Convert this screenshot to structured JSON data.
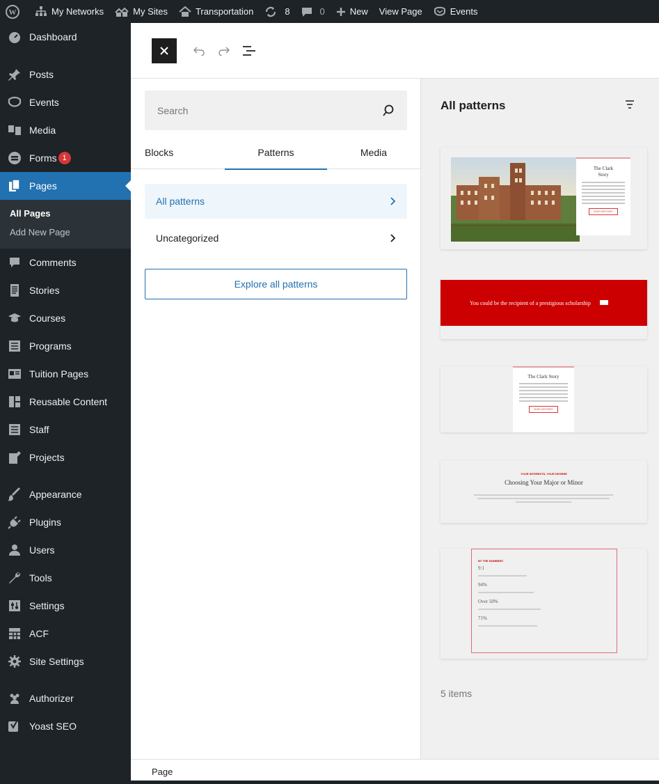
{
  "admin_bar": {
    "my_networks": "My Networks",
    "my_sites": "My Sites",
    "site_name": "Transportation",
    "updates_count": "8",
    "comments_count": "0",
    "new_label": "New",
    "view_page": "View Page",
    "events": "Events"
  },
  "sidebar": {
    "dashboard": "Dashboard",
    "posts": "Posts",
    "events": "Events",
    "media": "Media",
    "forms": "Forms",
    "forms_badge": "1",
    "pages": "Pages",
    "pages_sub": {
      "all_pages": "All Pages",
      "add_new": "Add New Page"
    },
    "comments": "Comments",
    "stories": "Stories",
    "courses": "Courses",
    "programs": "Programs",
    "tuition_pages": "Tuition Pages",
    "reusable_content": "Reusable Content",
    "staff": "Staff",
    "projects": "Projects",
    "appearance": "Appearance",
    "plugins": "Plugins",
    "users": "Users",
    "tools": "Tools",
    "settings": "Settings",
    "acf": "ACF",
    "site_settings": "Site Settings",
    "authorizer": "Authorizer",
    "yoast": "Yoast SEO"
  },
  "inserter": {
    "search_placeholder": "Search",
    "tabs": {
      "blocks": "Blocks",
      "patterns": "Patterns",
      "media": "Media"
    },
    "categories": {
      "all": "All patterns",
      "uncategorized": "Uncategorized"
    },
    "explore_label": "Explore all patterns"
  },
  "patterns_panel": {
    "title": "All patterns",
    "count": "5 items",
    "card1": {
      "title_line1": "The Clark",
      "title_line2": "Story",
      "button": "OUR HISTORY"
    },
    "card2": {
      "text": "You could be the recipient of a prestigious scholarship"
    },
    "card3": {
      "title": "The Clark Story",
      "button": "OUR HISTORY"
    },
    "card4": {
      "kicker": "YOUR INTERESTS, YOUR DEGREE",
      "title": "Choosing Your Major or Minor"
    },
    "card5": {
      "kicker": "BY THE NUMBERS",
      "n1": "9:1",
      "n2": "94%",
      "n3": "Over 50%",
      "n4": "71%"
    }
  },
  "footer": {
    "breadcrumb": "Page"
  },
  "colors": {
    "admin_dark": "#1d2327",
    "accent_blue": "#2271b1",
    "badge_red": "#d63638",
    "scholarship_red": "#cc0000"
  }
}
